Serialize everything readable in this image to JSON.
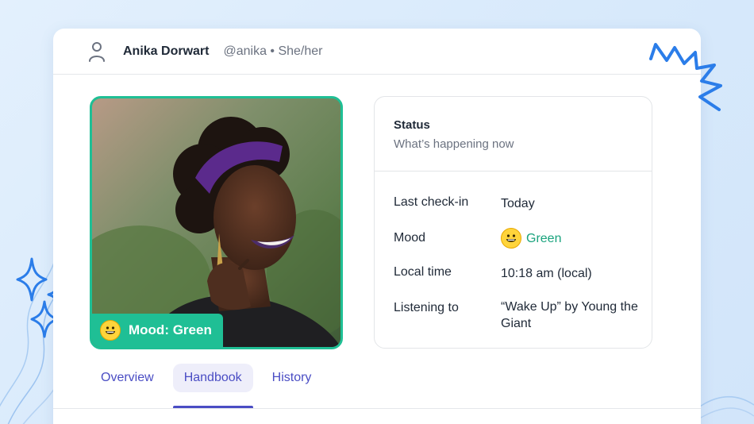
{
  "header": {
    "user_icon": "user-icon",
    "name": "Anika Dorwart",
    "handle": "@anika • She/her"
  },
  "profile": {
    "photo": "portrait-photo",
    "mood_badge": "Mood: Green",
    "mood_icon": "grinning-face-icon"
  },
  "status": {
    "title": "Status",
    "subtitle": "What’s happening now",
    "rows": [
      {
        "label": "Last check-in",
        "value": "Today"
      },
      {
        "label": "Mood",
        "value": "Green"
      },
      {
        "label": "Local time",
        "value": "10:18 am (local)"
      },
      {
        "label": "Listening to",
        "value": "“Wake Up” by Young the Giant"
      }
    ]
  },
  "tabs": [
    {
      "label": "Overview",
      "active": false
    },
    {
      "label": "Handbook",
      "active": true
    },
    {
      "label": "History",
      "active": false
    }
  ],
  "colors": {
    "accent": "#1fbf95",
    "mood_text": "#19a37d",
    "tab_text": "#4a4dc4",
    "tab_active_bg": "#eeeefa",
    "decoration_blue": "#2b7de9"
  }
}
